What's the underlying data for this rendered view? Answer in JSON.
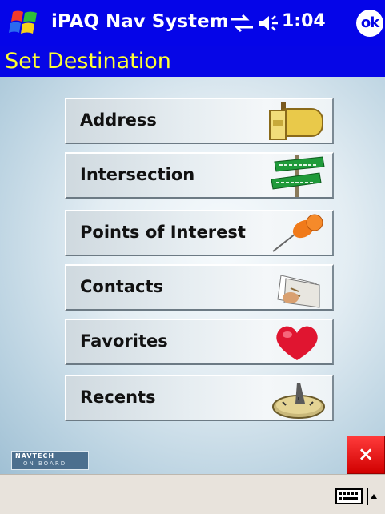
{
  "titlebar": {
    "app_title": "iPAQ Nav System",
    "time": "1:04",
    "ok_label": "ok"
  },
  "header": {
    "page_title": "Set Destination"
  },
  "menu": {
    "items": [
      {
        "label": "Address",
        "icon": "mailbox-icon"
      },
      {
        "label": "Intersection",
        "icon": "street-sign-icon"
      },
      {
        "label": "Points of Interest",
        "icon": "pushpin-icon"
      },
      {
        "label": "Contacts",
        "icon": "contacts-icon"
      },
      {
        "label": "Favorites",
        "icon": "heart-icon"
      },
      {
        "label": "Recents",
        "icon": "sundial-icon"
      }
    ]
  },
  "logo": {
    "brand": "NAVTECH",
    "tagline": "ON BOARD"
  },
  "close": {
    "label": "×"
  },
  "colors": {
    "titlebar": "#0505e8",
    "title_text": "#ffff33",
    "close": "#e00000"
  }
}
